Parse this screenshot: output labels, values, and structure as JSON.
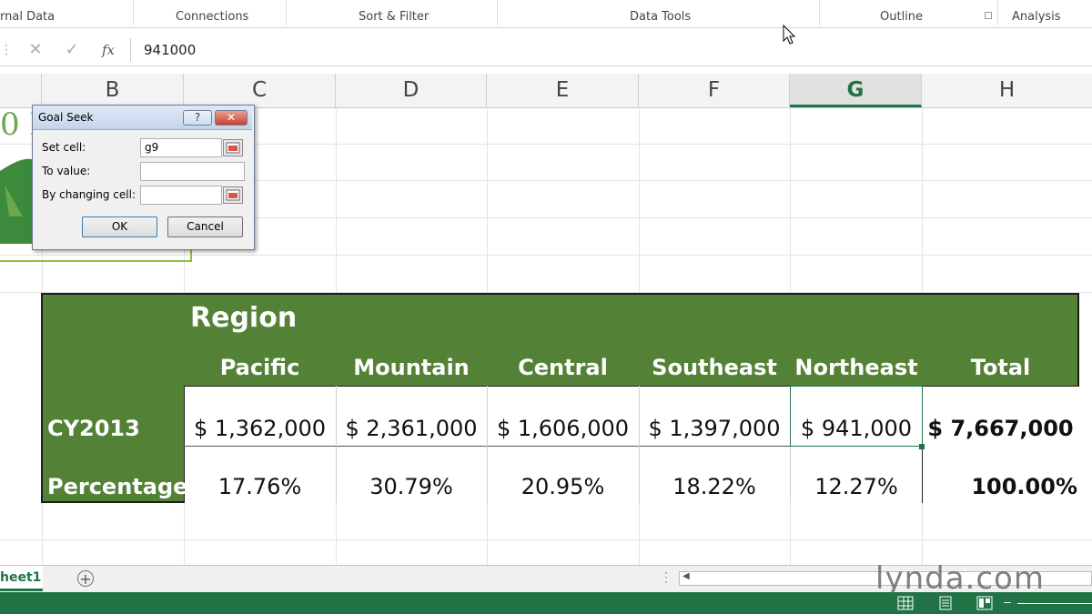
{
  "ribbon": {
    "groups": [
      "rnal Data",
      "Connections",
      "Sort & Filter",
      "Data Tools",
      "Outline",
      "Analysis"
    ]
  },
  "formula_bar": {
    "cancel": "✕",
    "enter": "✓",
    "fx": "fx",
    "value": "941000"
  },
  "columns": [
    "B",
    "C",
    "D",
    "E",
    "F",
    "G",
    "H"
  ],
  "active_column": "G",
  "table": {
    "region_label": "Region",
    "headers": [
      "Pacific",
      "Mountain",
      "Central",
      "Southeast",
      "Northeast",
      "Total"
    ],
    "rows": [
      {
        "label": "CY2013",
        "values": [
          "$ 1,362,000",
          "$ 2,361,000",
          "$ 1,606,000",
          "$ 1,397,000",
          "$ 941,000"
        ],
        "total": "$  7,667,000"
      },
      {
        "label": "Percentage",
        "values": [
          "17.76%",
          "30.79%",
          "20.95%",
          "18.22%",
          "12.27%"
        ],
        "total": "100.00%"
      }
    ]
  },
  "dialog": {
    "title": "Goal Seek",
    "help": "?",
    "close": "✕",
    "set_cell_label": "Set cell:",
    "set_cell_value": "g9",
    "to_value_label": "To value:",
    "to_value_value": "",
    "changing_cell_label": "By changing cell:",
    "changing_cell_value": "",
    "ok": "OK",
    "cancel": "Cancel"
  },
  "sheet_tab": "heet1",
  "add_sheet": "+",
  "watermark": "lynda.com",
  "colors": {
    "excel_green": "#217346",
    "table_header": "#538135"
  }
}
